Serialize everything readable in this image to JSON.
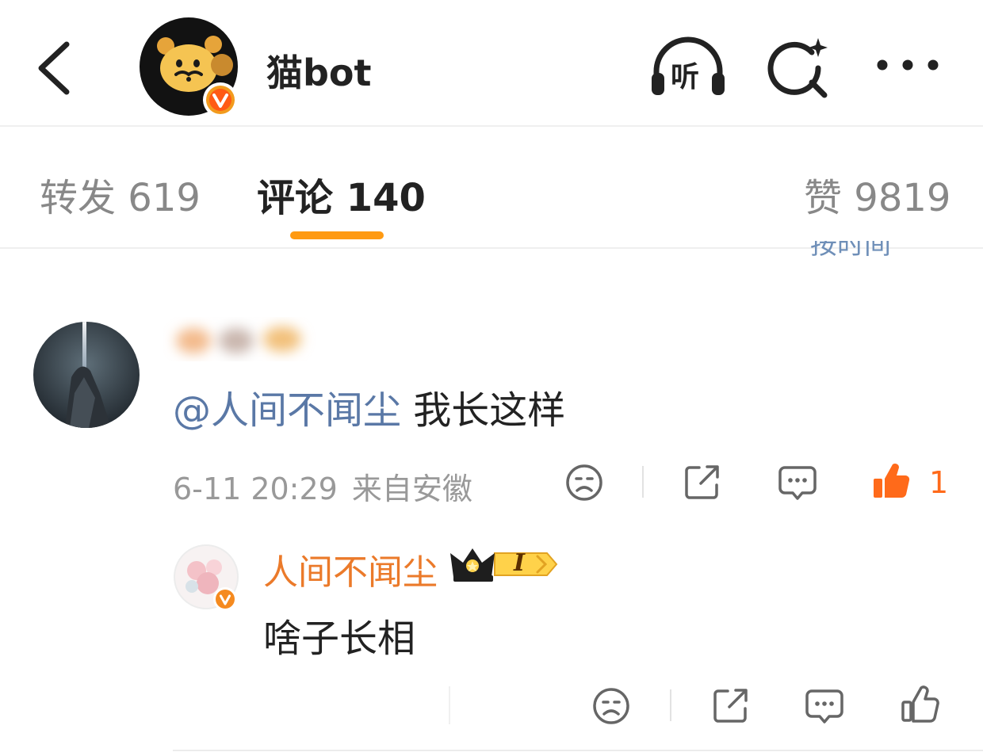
{
  "header": {
    "account_name": "猫bot",
    "listen_label": "听",
    "icons": {
      "back": "chevron-left-icon",
      "listen": "headphones-icon",
      "search": "search-sparkle-icon",
      "more": "more-dots-icon",
      "verified": "verified-v-icon"
    }
  },
  "tabs": [
    {
      "label": "转发",
      "count": "619",
      "active": false
    },
    {
      "label": "评论",
      "count": "140",
      "active": true
    },
    {
      "label": "赞",
      "count": "9819",
      "active": false
    }
  ],
  "sort_label": "按时间",
  "comment": {
    "mention": "@人间不闻尘",
    "text": " 我长这样",
    "time": "6-11 20:29",
    "location": "来自安徽",
    "like_count": "1"
  },
  "reply": {
    "name": "人间不闻尘",
    "badge_level": "I",
    "text": "啥子长相"
  },
  "colors": {
    "accent_orange": "#ff9a12",
    "like_orange": "#ff6a1a",
    "mention_blue": "#5a78a6",
    "reply_name_orange": "#eb7a2a",
    "muted_text": "#999999"
  }
}
